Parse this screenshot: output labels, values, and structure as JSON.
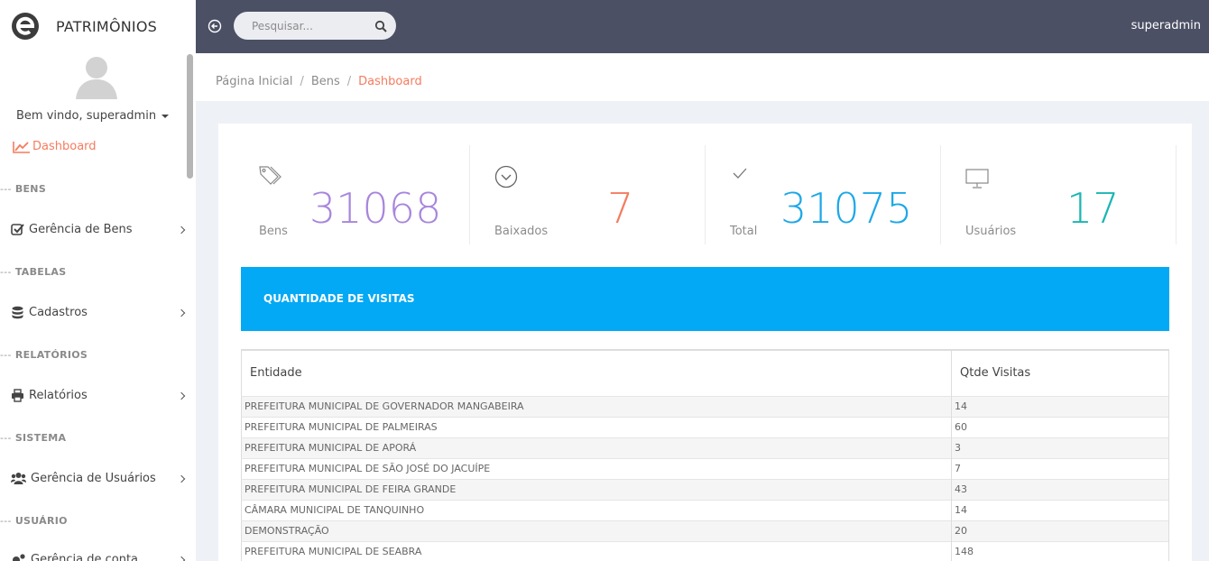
{
  "app": {
    "brand": "PATRIMÔNIOS"
  },
  "sidebar": {
    "welcome": "Bem vindo, superadmin",
    "dashboard": "Dashboard",
    "sections": [
      "BENS",
      "TABELAS",
      "RELATÓRIOS",
      "SISTEMA",
      "USUÁRIO"
    ],
    "section_prefix": "---",
    "items": [
      {
        "label": "Gerência de Bens"
      },
      {
        "label": "Cadastros"
      },
      {
        "label": "Relatórios"
      },
      {
        "label": "Gerência de Usuários"
      },
      {
        "label": "Gerência de conta"
      }
    ]
  },
  "topbar": {
    "search_placeholder": "Pesquisar...",
    "user": "superadmin"
  },
  "breadcrumb": {
    "home": "Página Inicial",
    "bens": "Bens",
    "current": "Dashboard"
  },
  "stats": [
    {
      "label": "Bens",
      "value": "31068",
      "color": "#a886dc",
      "icon": "tags-icon"
    },
    {
      "label": "Baixados",
      "value": "7",
      "color": "#f47c5f",
      "icon": "circle-chevron-down-icon"
    },
    {
      "label": "Total",
      "value": "31075",
      "color": "#1da8e8",
      "icon": "check-icon"
    },
    {
      "label": "Usuários",
      "value": "17",
      "color": "#19b6b2",
      "icon": "monitor-icon"
    }
  ],
  "visits": {
    "title": "QUANTIDADE DE VISITAS",
    "headers": [
      "Entidade",
      "Qtde Visitas"
    ],
    "rows": [
      [
        "PREFEITURA MUNICIPAL DE GOVERNADOR MANGABEIRA",
        "14"
      ],
      [
        "PREFEITURA MUNICIPAL DE PALMEIRAS",
        "60"
      ],
      [
        "PREFEITURA MUNICIPAL DE APORÁ",
        "3"
      ],
      [
        "PREFEITURA MUNICIPAL DE SÃO JOSÉ DO JACUÍPE",
        "7"
      ],
      [
        "PREFEITURA MUNICIPAL DE FEIRA GRANDE",
        "43"
      ],
      [
        "CÂMARA MUNICIPAL DE TANQUINHO",
        "14"
      ],
      [
        "DEMONSTRAÇÃO",
        "20"
      ],
      [
        "PREFEITURA MUNICIPAL DE SEABRA",
        "148"
      ]
    ]
  }
}
